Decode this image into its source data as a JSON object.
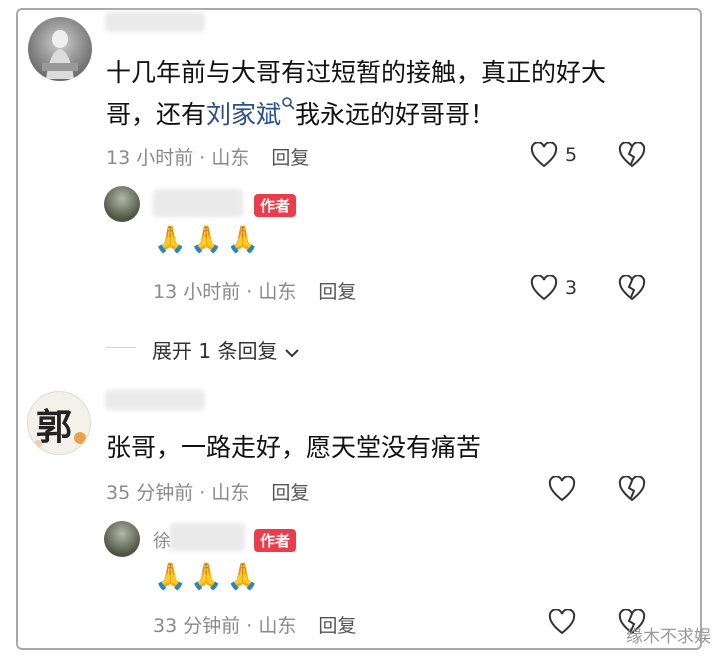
{
  "comments": [
    {
      "text_a": "十几年前与大哥有过短暂的接触，真正的好大",
      "text_b_prefix": "哥，还有",
      "link": "刘家斌",
      "text_b_suffix": "我永远的好哥哥！",
      "time": "13 小时前 · 山东",
      "reply_label": "回复",
      "likes": "5",
      "reply": {
        "badge": "作者",
        "emoji": "🙏🙏🙏",
        "time": "13 小时前 · 山东",
        "reply_label": "回复",
        "likes": "3"
      },
      "expand_label": "展开 1 条回复"
    },
    {
      "avatar_char": "郭",
      "text": "张哥，一路走好，愿天堂没有痛苦",
      "time": "35 分钟前 · 山东",
      "reply_label": "回复",
      "reply": {
        "name_partial": "徐",
        "badge": "作者",
        "emoji": "🙏🙏🙏",
        "time": "33 分钟前 · 山东",
        "reply_label": "回复"
      }
    }
  ],
  "watermark": "缘木不求娱",
  "colors": {
    "badge": "#ea3c4b",
    "link": "#2a4f8a"
  }
}
